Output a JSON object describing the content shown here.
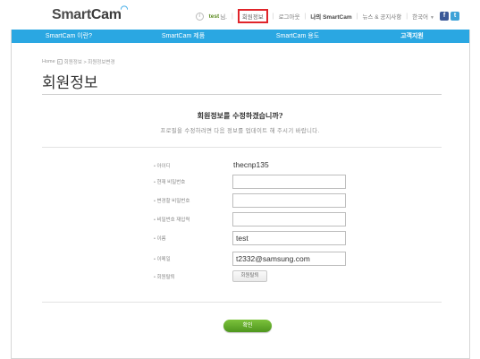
{
  "header": {
    "logo_smart": "Smart",
    "logo_cam": "Cam",
    "info_icon": "i",
    "user_name": "test",
    "user_suffix": "님.",
    "links": {
      "member_info": "회원정보",
      "logout": "로그아웃",
      "my_smartcam": "나의 SmartCam",
      "news": "뉴스 & 공지사항",
      "language": "한국어"
    },
    "social": {
      "facebook": "f",
      "twitter": "t"
    }
  },
  "menu": {
    "items": [
      "SmartCam 이란?",
      "SmartCam 제품",
      "SmartCam 용도",
      "고객지원"
    ]
  },
  "breadcrumb": {
    "home": "Home",
    "path": "회원정보 > 회원정보변경"
  },
  "page": {
    "title": "회원정보",
    "question": "회원정보를 수정하겠습니까?",
    "subtext": "프로필을 수정하려면 다음 정보를 업데이트 해 주시기 바랍니다."
  },
  "form": {
    "id_label": "아이디",
    "id_value": "thecnp135",
    "current_pw_label": "현재 비밀번호",
    "new_pw_label": "변경할 비밀번호",
    "confirm_pw_label": "비밀번호 재입력",
    "name_label": "이름",
    "name_value": "test",
    "email_label": "이메일",
    "email_value": "t2332@samsung.com",
    "withdraw_label": "회원탈퇴",
    "withdraw_button": "회원탈퇴"
  },
  "confirm_button": "확인",
  "colors": {
    "menu_bar": "#2aa7e2",
    "confirm_green": "#5ea82a",
    "highlight_red": "#e0252b",
    "user_green": "#5a8a1e"
  }
}
